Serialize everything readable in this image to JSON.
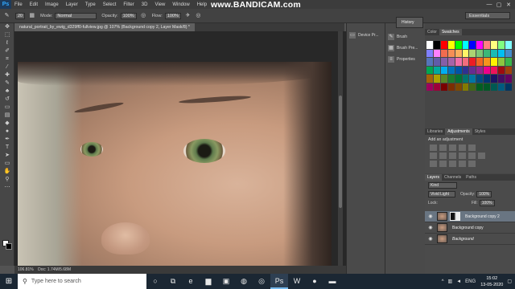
{
  "app": {
    "logo": "Ps"
  },
  "menubar": {
    "items": [
      "File",
      "Edit",
      "Image",
      "Layer",
      "Type",
      "Select",
      "Filter",
      "3D",
      "View",
      "Window",
      "Help"
    ]
  },
  "watermark": "www.BANDICAM.com",
  "window_controls": [
    "—",
    "▢",
    "✕"
  ],
  "options": {
    "brush_size": "20",
    "mode_label": "Mode:",
    "mode_value": "Normal",
    "opacity_label": "Opacity:",
    "opacity_value": "100%",
    "flow_label": "Flow:",
    "flow_value": "100%",
    "workspace": "Essentials"
  },
  "document": {
    "tab_title": "natural_portrait_by_ewig_d329ff0-fullview.jpg @ 107% (Background copy 2, Layer Mask/8) *",
    "zoom": "106.81%",
    "doc_info": "Doc: 1.74M/5.68M"
  },
  "panels_col1": {
    "items": [
      {
        "label": "Device Pr...",
        "icon": "device-preview-icon"
      }
    ]
  },
  "panels_col2": {
    "history_label": "History",
    "items": [
      {
        "label": "Brush",
        "icon": "brush-icon"
      },
      {
        "label": "Brush Pre...",
        "icon": "brush-presets-icon"
      },
      {
        "label": "Properties",
        "icon": "properties-icon"
      }
    ]
  },
  "swatches": {
    "tabs": [
      "Color",
      "Swatches"
    ],
    "colors": [
      "#ffffff",
      "#000000",
      "#ff0000",
      "#ffff00",
      "#00ff00",
      "#00ffff",
      "#0000ff",
      "#ff00ff",
      "#ff8080",
      "#ffff80",
      "#80ff80",
      "#80ffff",
      "#8080ff",
      "#ff80ff",
      "#f26c4f",
      "#f68e55",
      "#fbaf5d",
      "#fff467",
      "#acd372",
      "#7cc576",
      "#3bb878",
      "#1abbb4",
      "#00bff3",
      "#438ccb",
      "#5574b9",
      "#605ca8",
      "#855fa8",
      "#a763a8",
      "#f06ea9",
      "#f26d7d",
      "#ed1c24",
      "#f26522",
      "#f7941d",
      "#fff200",
      "#8dc63f",
      "#39b54a",
      "#00a651",
      "#00a99d",
      "#00aeef",
      "#0072bc",
      "#0054a6",
      "#2e3192",
      "#662d91",
      "#92278f",
      "#ec008c",
      "#ed145b",
      "#9e0b0f",
      "#a0410d",
      "#a3620a",
      "#aba000",
      "#598527",
      "#1a7b30",
      "#007236",
      "#00746b",
      "#0076a3",
      "#004b80",
      "#003471",
      "#1b1464",
      "#440e62",
      "#630460",
      "#9e005d",
      "#9e0039",
      "#790000",
      "#7b2e00",
      "#7d4900",
      "#827b00",
      "#406618",
      "#005e20",
      "#005826",
      "#005952",
      "#005b7f",
      "#003663"
    ]
  },
  "adjustments": {
    "tabs": [
      "Libraries",
      "Adjustments",
      "Styles"
    ],
    "title": "Add an adjustment"
  },
  "layers": {
    "tabs": [
      "Layers",
      "Channels",
      "Paths"
    ],
    "filter_label": "Kind",
    "blend_mode": "Vivid Light",
    "opacity_label": "Opacity:",
    "opacity_value": "100%",
    "lock_label": "Lock:",
    "fill_label": "Fill:",
    "fill_value": "100%",
    "rows": [
      {
        "name": "Background copy 2",
        "selected": true,
        "has_mask": true
      },
      {
        "name": "Background copy",
        "selected": false,
        "has_mask": false
      },
      {
        "name": "Background",
        "selected": false,
        "has_mask": false
      }
    ]
  },
  "taskbar": {
    "search_placeholder": "Type here to search",
    "apps": [
      "cortana-icon",
      "task-view-icon",
      "edge-icon",
      "explorer-icon",
      "store-icon",
      "firefox-icon",
      "chrome-icon",
      "photoshop-icon",
      "word-icon",
      "record-icon",
      "folder-icon"
    ],
    "language": "ENG",
    "time": "15:02",
    "date": "13-05-2020"
  }
}
